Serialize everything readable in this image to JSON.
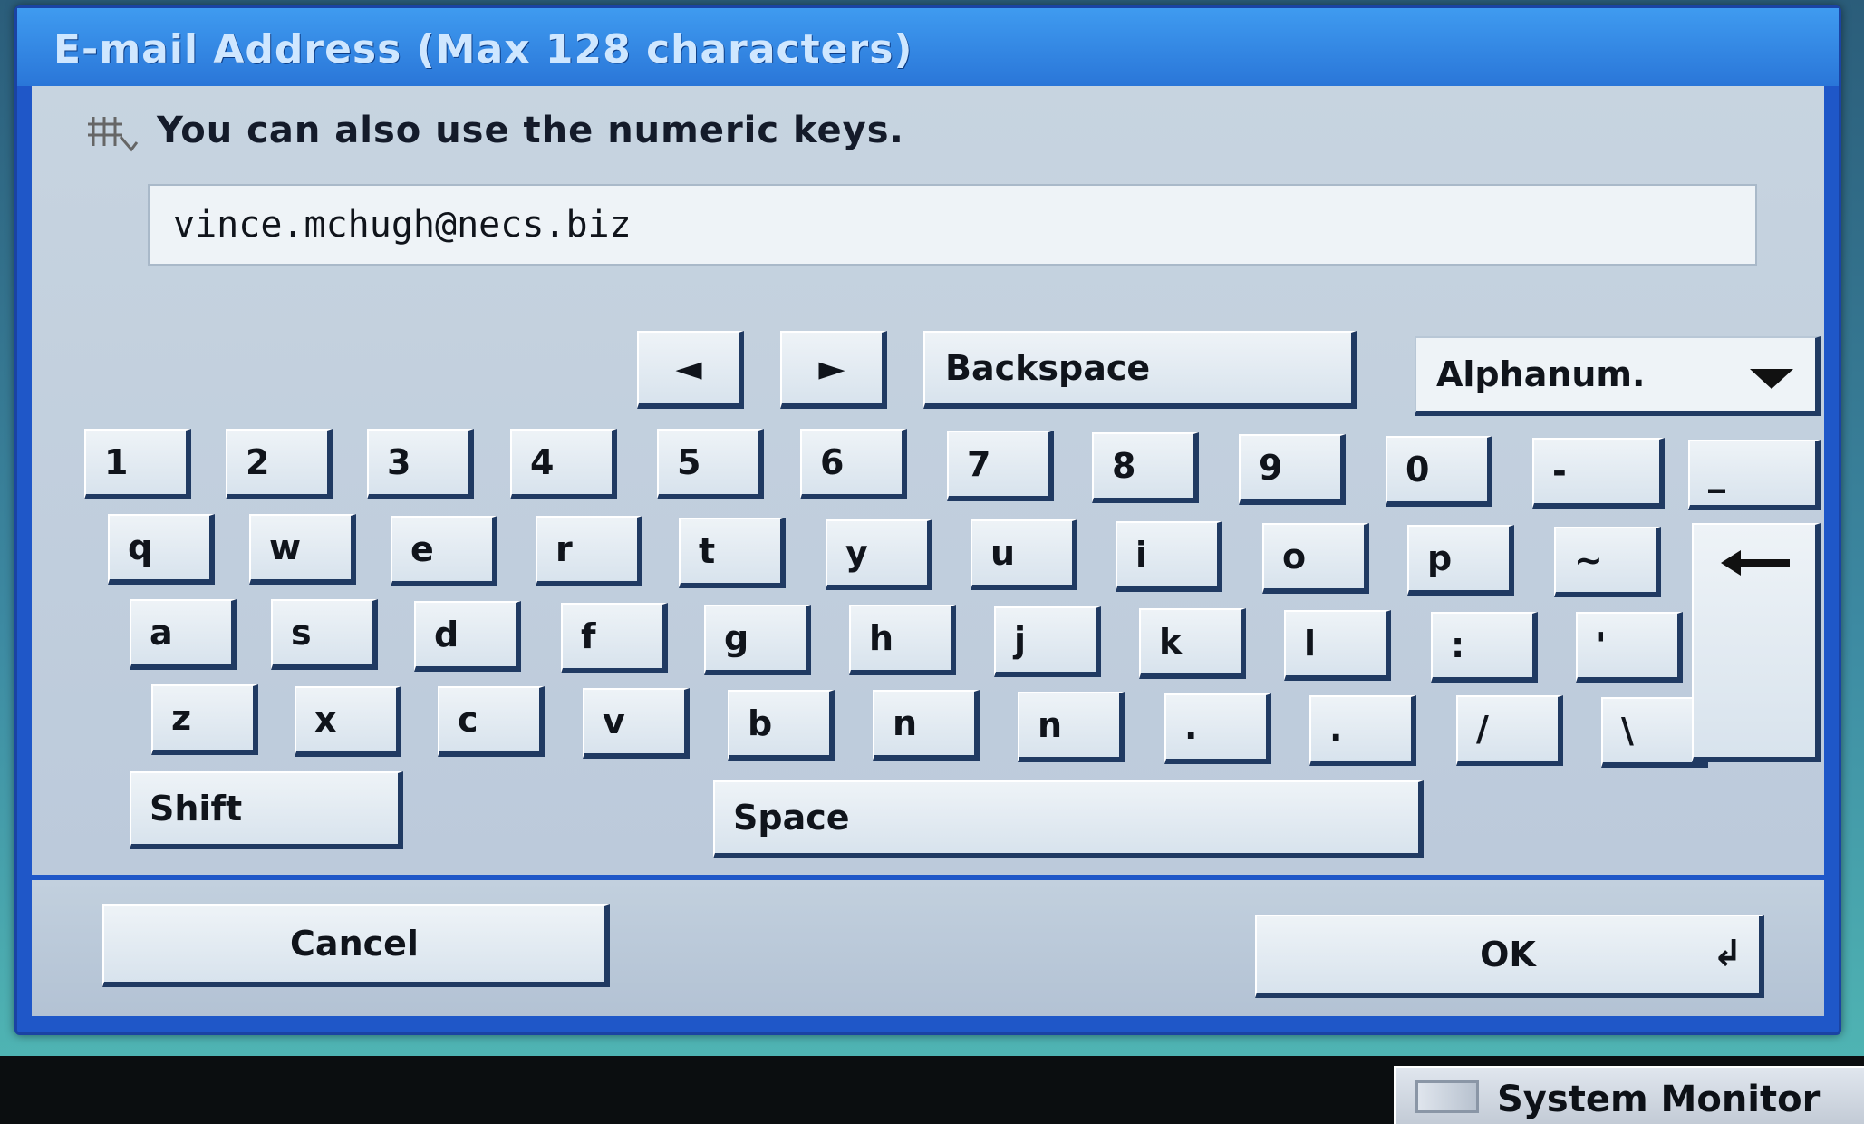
{
  "dialog": {
    "title": "E-mail Address (Max 128 characters)",
    "hint": "You can also use the numeric keys.",
    "email_value": "vince.mchugh@necs.biz"
  },
  "toolbar": {
    "left_arrow": "◄",
    "right_arrow": "►",
    "backspace": "Backspace",
    "mode": "Alphanum."
  },
  "keyboard": {
    "row1": [
      "1",
      "2",
      "3",
      "4",
      "5",
      "6",
      "7",
      "8",
      "9",
      "0",
      "-",
      "_"
    ],
    "row2": [
      "q",
      "w",
      "e",
      "r",
      "t",
      "y",
      "u",
      "i",
      "o",
      "p",
      "~"
    ],
    "row3": [
      "a",
      "s",
      "d",
      "f",
      "g",
      "h",
      "j",
      "k",
      "l",
      ":",
      "'"
    ],
    "row4": [
      "z",
      "x",
      "c",
      "v",
      "b",
      "n",
      "n",
      ".",
      ".",
      "/",
      "\\"
    ],
    "shift": "Shift",
    "space": "Space",
    "enter_symbol": "↵"
  },
  "footer": {
    "cancel": "Cancel",
    "ok": "OK",
    "ok_symbol": "↲"
  },
  "taskbar": {
    "system_monitor": "System Monitor"
  }
}
